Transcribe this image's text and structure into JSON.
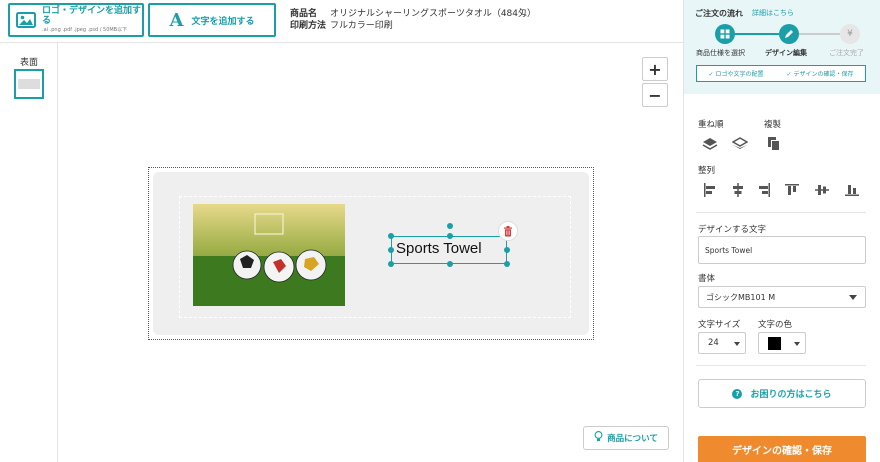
{
  "toolbar": {
    "add_logo_label": "ロゴ・デザインを追加する",
    "add_logo_formats": ".ai .png .pdf .jpeg .psd / 50MB以下",
    "add_text_label": "文字を追加する"
  },
  "product": {
    "name_key": "商品名",
    "name_value": "オリジナルシャーリングスポーツタオル（484匁）",
    "print_key": "印刷方法",
    "print_value": "フルカラー印刷"
  },
  "side": {
    "face_label": "表面"
  },
  "canvas": {
    "zoom_in": "+",
    "zoom_out": "−",
    "design_text": "Sports Towel",
    "about_button": "商品について"
  },
  "flow": {
    "title": "ご注文の流れ",
    "detail_link": "詳細はこちら",
    "steps": [
      {
        "label": "商品仕様を選択"
      },
      {
        "label": "デザイン編集"
      },
      {
        "label": "ご注文完了",
        "glyph": "¥"
      }
    ],
    "sub_steps": [
      "ロゴや文字の配置",
      "デザインの確認・保存"
    ]
  },
  "panel": {
    "layer_label": "重ね順",
    "duplicate_label": "複製",
    "align_label": "整列",
    "text_field_label": "デザインする文字",
    "text_field_value": "Sports Towel",
    "font_label": "書体",
    "font_value": "ゴシックMB101 M",
    "size_label": "文字サイズ",
    "size_value": "24",
    "color_label": "文字の色",
    "color_value": "#000000",
    "help_label": "お困りの方はこちら",
    "save_label": "デザインの確認・保存"
  },
  "colors": {
    "accent": "#1a9fa8",
    "save": "#f08a2e"
  }
}
